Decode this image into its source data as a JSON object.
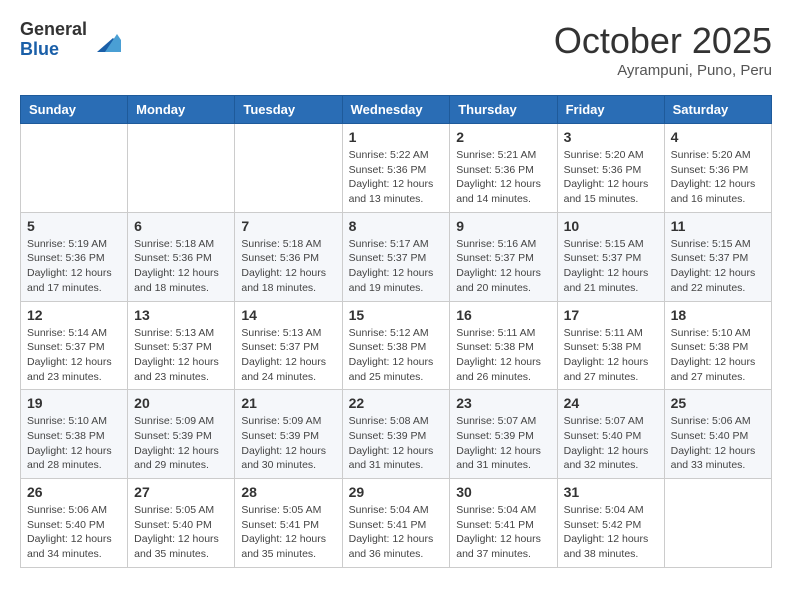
{
  "logo": {
    "general": "General",
    "blue": "Blue"
  },
  "header": {
    "month": "October 2025",
    "location": "Ayrampuni, Puno, Peru"
  },
  "weekdays": [
    "Sunday",
    "Monday",
    "Tuesday",
    "Wednesday",
    "Thursday",
    "Friday",
    "Saturday"
  ],
  "weeks": [
    [
      {
        "day": "",
        "info": ""
      },
      {
        "day": "",
        "info": ""
      },
      {
        "day": "",
        "info": ""
      },
      {
        "day": "1",
        "info": "Sunrise: 5:22 AM\nSunset: 5:36 PM\nDaylight: 12 hours\nand 13 minutes."
      },
      {
        "day": "2",
        "info": "Sunrise: 5:21 AM\nSunset: 5:36 PM\nDaylight: 12 hours\nand 14 minutes."
      },
      {
        "day": "3",
        "info": "Sunrise: 5:20 AM\nSunset: 5:36 PM\nDaylight: 12 hours\nand 15 minutes."
      },
      {
        "day": "4",
        "info": "Sunrise: 5:20 AM\nSunset: 5:36 PM\nDaylight: 12 hours\nand 16 minutes."
      }
    ],
    [
      {
        "day": "5",
        "info": "Sunrise: 5:19 AM\nSunset: 5:36 PM\nDaylight: 12 hours\nand 17 minutes."
      },
      {
        "day": "6",
        "info": "Sunrise: 5:18 AM\nSunset: 5:36 PM\nDaylight: 12 hours\nand 18 minutes."
      },
      {
        "day": "7",
        "info": "Sunrise: 5:18 AM\nSunset: 5:36 PM\nDaylight: 12 hours\nand 18 minutes."
      },
      {
        "day": "8",
        "info": "Sunrise: 5:17 AM\nSunset: 5:37 PM\nDaylight: 12 hours\nand 19 minutes."
      },
      {
        "day": "9",
        "info": "Sunrise: 5:16 AM\nSunset: 5:37 PM\nDaylight: 12 hours\nand 20 minutes."
      },
      {
        "day": "10",
        "info": "Sunrise: 5:15 AM\nSunset: 5:37 PM\nDaylight: 12 hours\nand 21 minutes."
      },
      {
        "day": "11",
        "info": "Sunrise: 5:15 AM\nSunset: 5:37 PM\nDaylight: 12 hours\nand 22 minutes."
      }
    ],
    [
      {
        "day": "12",
        "info": "Sunrise: 5:14 AM\nSunset: 5:37 PM\nDaylight: 12 hours\nand 23 minutes."
      },
      {
        "day": "13",
        "info": "Sunrise: 5:13 AM\nSunset: 5:37 PM\nDaylight: 12 hours\nand 23 minutes."
      },
      {
        "day": "14",
        "info": "Sunrise: 5:13 AM\nSunset: 5:37 PM\nDaylight: 12 hours\nand 24 minutes."
      },
      {
        "day": "15",
        "info": "Sunrise: 5:12 AM\nSunset: 5:38 PM\nDaylight: 12 hours\nand 25 minutes."
      },
      {
        "day": "16",
        "info": "Sunrise: 5:11 AM\nSunset: 5:38 PM\nDaylight: 12 hours\nand 26 minutes."
      },
      {
        "day": "17",
        "info": "Sunrise: 5:11 AM\nSunset: 5:38 PM\nDaylight: 12 hours\nand 27 minutes."
      },
      {
        "day": "18",
        "info": "Sunrise: 5:10 AM\nSunset: 5:38 PM\nDaylight: 12 hours\nand 27 minutes."
      }
    ],
    [
      {
        "day": "19",
        "info": "Sunrise: 5:10 AM\nSunset: 5:38 PM\nDaylight: 12 hours\nand 28 minutes."
      },
      {
        "day": "20",
        "info": "Sunrise: 5:09 AM\nSunset: 5:39 PM\nDaylight: 12 hours\nand 29 minutes."
      },
      {
        "day": "21",
        "info": "Sunrise: 5:09 AM\nSunset: 5:39 PM\nDaylight: 12 hours\nand 30 minutes."
      },
      {
        "day": "22",
        "info": "Sunrise: 5:08 AM\nSunset: 5:39 PM\nDaylight: 12 hours\nand 31 minutes."
      },
      {
        "day": "23",
        "info": "Sunrise: 5:07 AM\nSunset: 5:39 PM\nDaylight: 12 hours\nand 31 minutes."
      },
      {
        "day": "24",
        "info": "Sunrise: 5:07 AM\nSunset: 5:40 PM\nDaylight: 12 hours\nand 32 minutes."
      },
      {
        "day": "25",
        "info": "Sunrise: 5:06 AM\nSunset: 5:40 PM\nDaylight: 12 hours\nand 33 minutes."
      }
    ],
    [
      {
        "day": "26",
        "info": "Sunrise: 5:06 AM\nSunset: 5:40 PM\nDaylight: 12 hours\nand 34 minutes."
      },
      {
        "day": "27",
        "info": "Sunrise: 5:05 AM\nSunset: 5:40 PM\nDaylight: 12 hours\nand 35 minutes."
      },
      {
        "day": "28",
        "info": "Sunrise: 5:05 AM\nSunset: 5:41 PM\nDaylight: 12 hours\nand 35 minutes."
      },
      {
        "day": "29",
        "info": "Sunrise: 5:04 AM\nSunset: 5:41 PM\nDaylight: 12 hours\nand 36 minutes."
      },
      {
        "day": "30",
        "info": "Sunrise: 5:04 AM\nSunset: 5:41 PM\nDaylight: 12 hours\nand 37 minutes."
      },
      {
        "day": "31",
        "info": "Sunrise: 5:04 AM\nSunset: 5:42 PM\nDaylight: 12 hours\nand 38 minutes."
      },
      {
        "day": "",
        "info": ""
      }
    ]
  ]
}
